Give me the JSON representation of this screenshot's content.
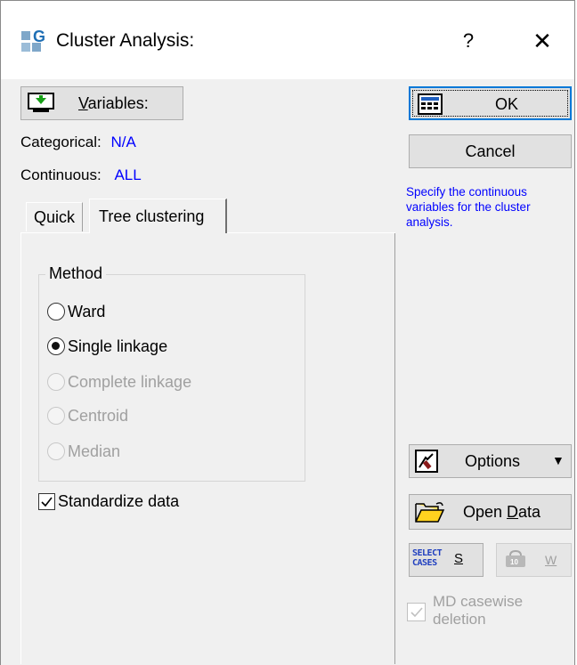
{
  "window": {
    "title": "Cluster Analysis:",
    "help_label": "?",
    "close_label": "✕"
  },
  "variables_button": {
    "prefix": "",
    "hotkey": "V",
    "rest": "ariables:"
  },
  "categorical": {
    "label": "Categorical:",
    "value": "N/A"
  },
  "continuous": {
    "label": "Continuous:",
    "value": "ALL"
  },
  "tabs": [
    {
      "label": "Quick"
    },
    {
      "label": "Tree clustering"
    }
  ],
  "method": {
    "title": "Method",
    "options": [
      {
        "label": "Ward",
        "selected": false,
        "enabled": true
      },
      {
        "label": "Single linkage",
        "selected": true,
        "enabled": true
      },
      {
        "label": "Complete linkage",
        "selected": false,
        "enabled": false
      },
      {
        "label": "Centroid",
        "selected": false,
        "enabled": false
      },
      {
        "label": "Median",
        "selected": false,
        "enabled": false
      }
    ]
  },
  "standardize": {
    "label": "Standardize data",
    "checked": true
  },
  "ok_button": {
    "label": "OK"
  },
  "cancel_button": {
    "label": "Cancel"
  },
  "hint_text": "Specify the continuous variables for the cluster analysis.",
  "options_button": {
    "label": "Options"
  },
  "open_data_button": {
    "prefix": "Open ",
    "hotkey": "D",
    "rest": "ata"
  },
  "select_cases_button": {
    "icon_text_1": "SELECT",
    "icon_text_2": "CASES",
    "label": "S"
  },
  "weight_button": {
    "label": "W"
  },
  "md_casewise": {
    "label": "MD casewise deletion",
    "checked": true,
    "enabled": false
  }
}
